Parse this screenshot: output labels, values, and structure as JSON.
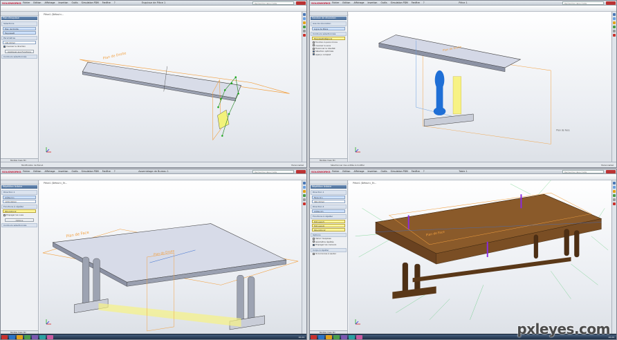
{
  "app": {
    "logo": "SOLIDWORKS",
    "menus": [
      "Fichier",
      "Edition",
      "Affichage",
      "Insertion",
      "Outils",
      "Simulation PDM",
      "Fenêtre",
      "?"
    ],
    "search_placeholder": "Rechercher dans l'Aide",
    "taskbar_time": "10:24"
  },
  "windows": [
    {
      "id": "q1",
      "doc_title": "Esquisse de Pièce 1",
      "cmd_tabs": [
        "Fonctions",
        "Esquisse",
        "Evaluer",
        "DimXpert",
        "Modèle de Surface"
      ],
      "active_tab": "Fonctions",
      "breadcrumb": "Pièce1 (Défaut<<Défaut>...",
      "panel_title": "Plan d'esquisse",
      "panel_groups": [
        {
          "title": "Sélections",
          "rows": [
            {
              "type": "box",
              "style": "blue",
              "text": "Plan de Droite"
            },
            {
              "type": "box",
              "style": "blue",
              "text": "Esquisse8"
            }
          ]
        },
        {
          "title": "Paramètres",
          "rows": [
            {
              "type": "box",
              "style": "",
              "text": "100.00mm"
            },
            {
              "type": "check",
              "on": true,
              "text": "Inverser la direction"
            },
            {
              "type": "button",
              "text": "Appliquer aux Fonctions"
            }
          ]
        },
        {
          "title": "Contours sélectionnés",
          "rows": []
        }
      ],
      "bottom_tabs": "Modèle  Vues 3D",
      "status": "Modification de Pièce1",
      "status_right": "Personnalisé"
    },
    {
      "id": "q2",
      "doc_title": "Pièce 1",
      "cmd_tabs": [
        "Fonctions",
        "Esquisse",
        "Evaluer",
        "DimXpert",
        "Modèle de Surface",
        "Tôlerie"
      ],
      "active_tab": "Fonctions",
      "breadcrumb": "",
      "panel_title": "Fonction de révolution",
      "panel_groups": [
        {
          "title": "Axe de révolution",
          "rows": [
            {
              "type": "box",
              "style": "blue",
              "text": "Ligne de Pièce"
            }
          ]
        },
        {
          "title": "Contours sélectionnés",
          "rows": [
            {
              "type": "box",
              "style": "sel",
              "text": "Esquisse8-Région1"
            },
            {
              "type": "check",
              "on": false,
              "text": "Fonction à paroi mince"
            },
            {
              "type": "check",
              "on": false,
              "text": "Inverser le sens"
            },
            {
              "type": "check",
              "on": false,
              "text": "Fusionner le résultat"
            },
            {
              "type": "check",
              "on": true,
              "text": "Sélection optimale"
            },
            {
              "type": "check",
              "on": true,
              "text": "Aperçu complet"
            }
          ]
        }
      ],
      "bottom_tabs": "Modèle  Vues 3D",
      "status": "Sélectionner des entités à modifier",
      "status_right": "Personnalisé"
    },
    {
      "id": "q3",
      "doc_title": "Assemblage de Bureau 1",
      "cmd_tabs": [
        "Fonctions",
        "Esquisse",
        "Evaluer",
        "DimXpert",
        "Modèle de Surface",
        "Tôlerie"
      ],
      "active_tab": "Fonctions",
      "breadcrumb": "Pièce1 (Défaut<<Défaut>_Et...",
      "panel_title": "Répétition linéaire",
      "panel_groups": [
        {
          "title": "Direction 1",
          "rows": [
            {
              "type": "box",
              "style": "blue",
              "text": "Arête<1>"
            },
            {
              "type": "box",
              "style": "",
              "text": "1150.00mm"
            }
          ]
        },
        {
          "title": "Fonctions à répéter",
          "rows": [
            {
              "type": "box",
              "style": "sel",
              "text": "Révolution2"
            },
            {
              "type": "check",
              "on": false,
              "text": "Propager les vues"
            },
            {
              "type": "button",
              "text": "Options"
            }
          ]
        },
        {
          "title": "Contours sélectionnés",
          "rows": []
        }
      ],
      "bottom_tabs": "Modèle  Vues 3D",
      "status": "Sélectionner des entités à modifier",
      "status_right": "Personnalisé"
    },
    {
      "id": "q4",
      "doc_title": "Table 1",
      "cmd_tabs": [
        "Fonctions",
        "Esquisse",
        "Evaluer",
        "DimXpert",
        "Modèle de Surface",
        "Tôlerie",
        "Outils"
      ],
      "active_tab": "Fonctions",
      "breadcrumb": "Pièce1 (Défaut<<Défaut>_Et...",
      "panel_title": "Répétition linéaire",
      "panel_groups": [
        {
          "title": "Direction 1",
          "rows": [
            {
              "type": "box",
              "style": "blue",
              "text": "Face<1>"
            },
            {
              "type": "box",
              "style": "",
              "text": "940.00mm"
            }
          ]
        },
        {
          "title": "Direction 2",
          "rows": [
            {
              "type": "box",
              "style": "blue",
              "text": "Arête<2>"
            }
          ]
        },
        {
          "title": "Fonctions à répéter",
          "rows": [
            {
              "type": "box",
              "style": "sel",
              "text": "Extrusion5"
            },
            {
              "type": "box",
              "style": "sel",
              "text": "Extrusion6"
            },
            {
              "type": "box",
              "style": "sel",
              "text": "Révolution2"
            }
          ]
        },
        {
          "title": "Options",
          "rows": [
            {
              "type": "check",
              "on": false,
              "text": "Varier l'esquisse"
            },
            {
              "type": "check",
              "on": false,
              "text": "Géométrie répétée"
            },
            {
              "type": "check",
              "on": true,
              "text": "Propager les couleurs"
            }
          ]
        },
        {
          "title": "Corps à répéter",
          "rows": [
            {
              "type": "check",
              "on": false,
              "text": "Occurrences à sauter"
            }
          ]
        }
      ],
      "bottom_tabs": "Modèle  Vues 3D",
      "status": "Sélectionner des entités à modifier",
      "status_right": "Personnalisé"
    }
  ],
  "annotations": {
    "q1": [
      "Plan de Droite"
    ],
    "q2": [
      "Plan de Droite",
      "Plan de Face"
    ],
    "q3": [
      "Plan de Face",
      "Plan de Droite"
    ],
    "q4": [
      "Plan de Face"
    ]
  },
  "watermark": "pxleyes.com"
}
